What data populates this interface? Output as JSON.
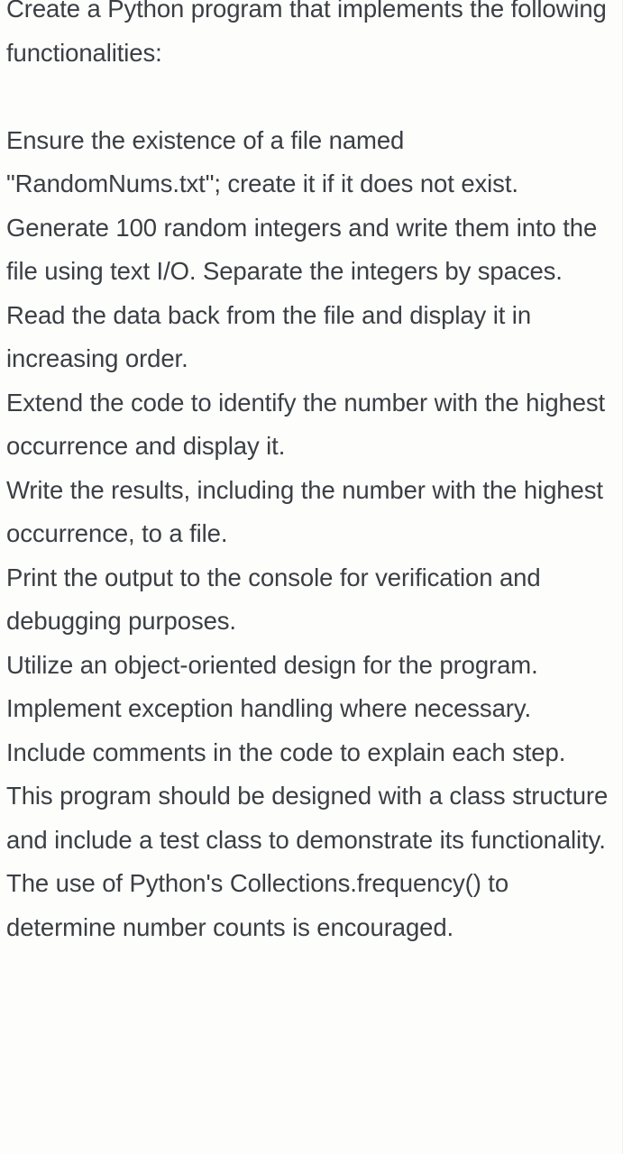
{
  "document": {
    "intro": "Create a Python program that implements the following functionalities:",
    "requirements": [
      "Ensure the existence of a file named \"RandomNums.txt\"; create it if it does not exist.",
      "Generate 100 random integers and write them into the file using text I/O. Separate the integers by spaces.",
      "Read the data back from the file and display it in increasing order.",
      "Extend the code to identify the number with the highest occurrence and display it.",
      "Write the results, including the number with the highest occurrence, to a file.",
      "Print the output to the console for verification and debugging purposes.",
      "Utilize an object-oriented design for the program.",
      "Implement exception handling where necessary.",
      "Include comments in the code to explain each step.",
      "This program should be designed with a class structure and include a test class to demonstrate its functionality. The use of Python's Collections.frequency() to determine number counts is encouraged."
    ]
  },
  "style": {
    "text_color": "#3b3f44",
    "background_color": "#fdfdfc",
    "border_color": "#f0f0ee"
  }
}
